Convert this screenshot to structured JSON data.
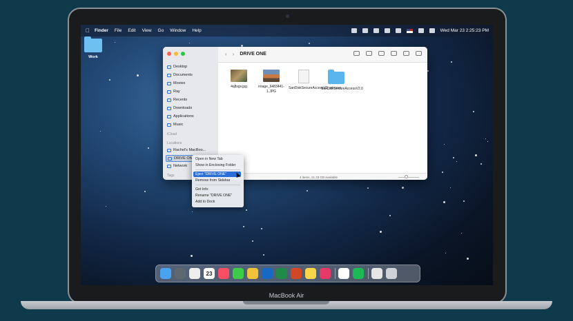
{
  "device_label": "MacBook Air",
  "menubar": {
    "app_name": "Finder",
    "menus": [
      "File",
      "Edit",
      "View",
      "Go",
      "Window",
      "Help"
    ],
    "datetime": "Wed Mar 23  2:25:23 PM"
  },
  "desktop": {
    "folder_label": "Work"
  },
  "finder": {
    "title": "DRIVE ONE",
    "sidebar": {
      "favorites": [
        "Desktop",
        "Documents",
        "Movies",
        "Ray",
        "Recents",
        "Downloads",
        "Applications",
        "Music"
      ],
      "icloud_header": "iCloud",
      "locations_header": "Locations",
      "locations": [
        "Rachel's MacBoo...",
        "DRIVE ONE",
        "Network"
      ],
      "tags_header": "Tags"
    },
    "files": [
      {
        "name": "4q8sgv.jpg"
      },
      {
        "name": "image_6483441-1.JPG"
      },
      {
        "name": "SanDiskSecureAccessV2_win.exe"
      },
      {
        "name": "SanDiskSecureAccessV2.0"
      }
    ],
    "status": "4 items, 21.33 GB available"
  },
  "context_menu": {
    "items": [
      "Open in New Tab",
      "Show in Enclosing Folder",
      "Eject \"DRIVE ONE\"",
      "Remove from Sidebar",
      "Get Info",
      "Rename \"DRIVE ONE\"",
      "Add to Dock"
    ],
    "highlighted": "Eject \"DRIVE ONE\""
  },
  "dock": {
    "apps": [
      {
        "name": "Finder",
        "color": "#4aa3ee"
      },
      {
        "name": "Launchpad",
        "color": "#5f6770"
      },
      {
        "name": "Photos",
        "color": "#eeeeee"
      },
      {
        "name": "Calendar",
        "color": "#ffffff"
      },
      {
        "name": "Music",
        "color": "#fa4e63"
      },
      {
        "name": "Messages",
        "color": "#3ecb4a"
      },
      {
        "name": "Chrome",
        "color": "#f0c33a"
      },
      {
        "name": "Outlook",
        "color": "#1769c4"
      },
      {
        "name": "Excel",
        "color": "#1f8a4a"
      },
      {
        "name": "PowerPoint",
        "color": "#d24726"
      },
      {
        "name": "Notes",
        "color": "#f9d648"
      },
      {
        "name": "Airmail",
        "color": "#e63968"
      },
      {
        "name": "Slack",
        "color": "#ffffff"
      },
      {
        "name": "Spotify",
        "color": "#1db954"
      },
      {
        "name": "Documents",
        "color": "#e6e6e6"
      },
      {
        "name": "Trash",
        "color": "#cfd3d8"
      }
    ],
    "calendar_day": "23"
  }
}
